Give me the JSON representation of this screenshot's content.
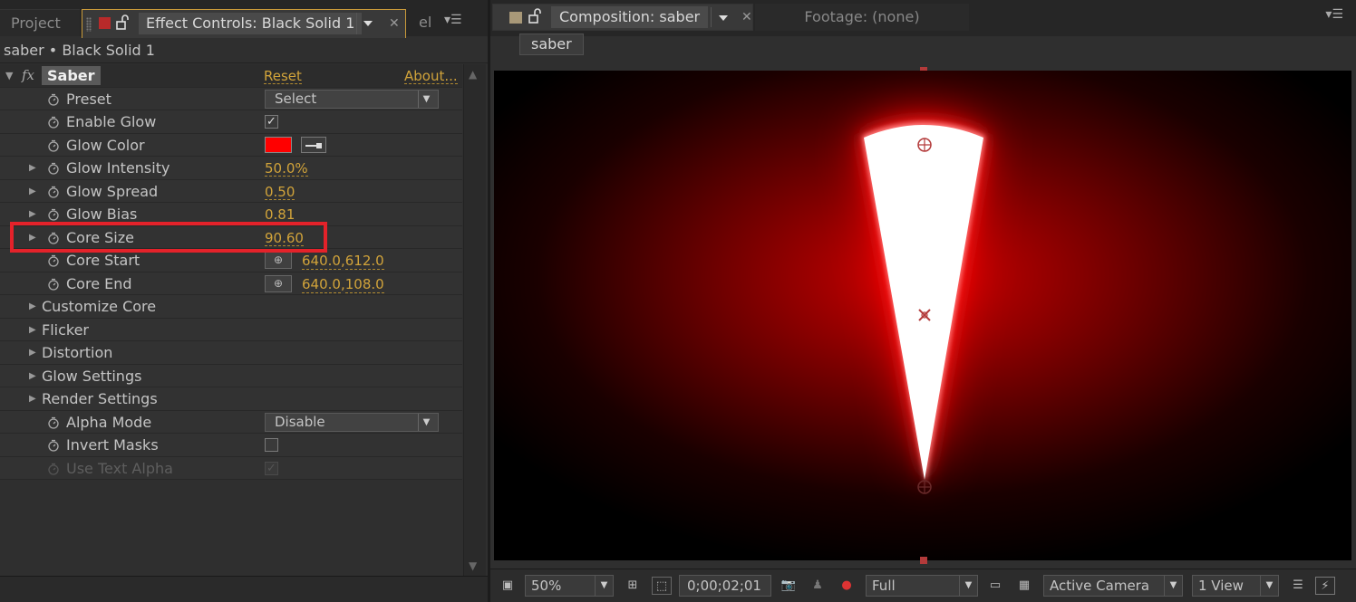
{
  "left_panel": {
    "tabs": {
      "project": "Project",
      "effect_controls": "Effect Controls: Black Solid 1",
      "overflow": "el"
    },
    "breadcrumb": "saber • Black Solid 1",
    "effect": {
      "name": "Saber",
      "reset": "Reset",
      "about": "About..."
    },
    "properties": [
      {
        "label": "Preset",
        "type": "select",
        "value": "Select"
      },
      {
        "label": "Enable Glow",
        "type": "checkbox",
        "checked": true
      },
      {
        "label": "Glow Color",
        "type": "color",
        "color": "#ff0000"
      },
      {
        "label": "Glow Intensity",
        "type": "value",
        "value": "50.0%"
      },
      {
        "label": "Glow Spread",
        "type": "value",
        "value": "0.50"
      },
      {
        "label": "Glow Bias",
        "type": "value",
        "value": "0.81"
      },
      {
        "label": "Core Size",
        "type": "value",
        "value": "90.60",
        "highlighted": true
      },
      {
        "label": "Core Start",
        "type": "point",
        "x": "640.0",
        "y": "612.0"
      },
      {
        "label": "Core End",
        "type": "point",
        "x": "640.0",
        "y": "108.0"
      }
    ],
    "groups": [
      "Customize Core",
      "Flicker",
      "Distortion",
      "Glow Settings",
      "Render Settings"
    ],
    "tail_properties": [
      {
        "label": "Alpha Mode",
        "type": "select",
        "value": "Disable"
      },
      {
        "label": "Invert Masks",
        "type": "checkbox",
        "checked": false
      },
      {
        "label": "Use Text Alpha",
        "type": "checkbox",
        "checked": true,
        "disabled": true
      }
    ]
  },
  "right_panel": {
    "tabs": {
      "composition": "Composition: saber",
      "footage": "Footage: (none)"
    },
    "comp_breadcrumb": "saber",
    "viewer_bar": {
      "zoom": "50%",
      "timecode": "0;00;02;01",
      "resolution": "Full",
      "camera": "Active Camera",
      "views": "1 View"
    }
  },
  "colors": {
    "accent_value": "#d1a33a",
    "highlight_box": "#e4222a",
    "glow": "#ff0000"
  }
}
